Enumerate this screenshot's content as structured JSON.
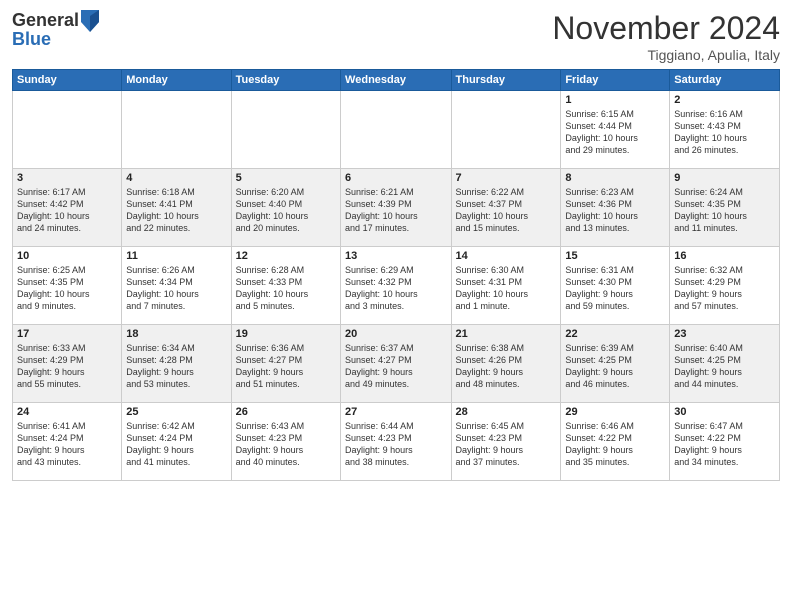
{
  "header": {
    "logo_general": "General",
    "logo_blue": "Blue",
    "month_title": "November 2024",
    "location": "Tiggiano, Apulia, Italy"
  },
  "weekdays": [
    "Sunday",
    "Monday",
    "Tuesday",
    "Wednesday",
    "Thursday",
    "Friday",
    "Saturday"
  ],
  "weeks": [
    [
      {
        "day": "",
        "info": ""
      },
      {
        "day": "",
        "info": ""
      },
      {
        "day": "",
        "info": ""
      },
      {
        "day": "",
        "info": ""
      },
      {
        "day": "",
        "info": ""
      },
      {
        "day": "1",
        "info": "Sunrise: 6:15 AM\nSunset: 4:44 PM\nDaylight: 10 hours\nand 29 minutes."
      },
      {
        "day": "2",
        "info": "Sunrise: 6:16 AM\nSunset: 4:43 PM\nDaylight: 10 hours\nand 26 minutes."
      }
    ],
    [
      {
        "day": "3",
        "info": "Sunrise: 6:17 AM\nSunset: 4:42 PM\nDaylight: 10 hours\nand 24 minutes."
      },
      {
        "day": "4",
        "info": "Sunrise: 6:18 AM\nSunset: 4:41 PM\nDaylight: 10 hours\nand 22 minutes."
      },
      {
        "day": "5",
        "info": "Sunrise: 6:20 AM\nSunset: 4:40 PM\nDaylight: 10 hours\nand 20 minutes."
      },
      {
        "day": "6",
        "info": "Sunrise: 6:21 AM\nSunset: 4:39 PM\nDaylight: 10 hours\nand 17 minutes."
      },
      {
        "day": "7",
        "info": "Sunrise: 6:22 AM\nSunset: 4:37 PM\nDaylight: 10 hours\nand 15 minutes."
      },
      {
        "day": "8",
        "info": "Sunrise: 6:23 AM\nSunset: 4:36 PM\nDaylight: 10 hours\nand 13 minutes."
      },
      {
        "day": "9",
        "info": "Sunrise: 6:24 AM\nSunset: 4:35 PM\nDaylight: 10 hours\nand 11 minutes."
      }
    ],
    [
      {
        "day": "10",
        "info": "Sunrise: 6:25 AM\nSunset: 4:35 PM\nDaylight: 10 hours\nand 9 minutes."
      },
      {
        "day": "11",
        "info": "Sunrise: 6:26 AM\nSunset: 4:34 PM\nDaylight: 10 hours\nand 7 minutes."
      },
      {
        "day": "12",
        "info": "Sunrise: 6:28 AM\nSunset: 4:33 PM\nDaylight: 10 hours\nand 5 minutes."
      },
      {
        "day": "13",
        "info": "Sunrise: 6:29 AM\nSunset: 4:32 PM\nDaylight: 10 hours\nand 3 minutes."
      },
      {
        "day": "14",
        "info": "Sunrise: 6:30 AM\nSunset: 4:31 PM\nDaylight: 10 hours\nand 1 minute."
      },
      {
        "day": "15",
        "info": "Sunrise: 6:31 AM\nSunset: 4:30 PM\nDaylight: 9 hours\nand 59 minutes."
      },
      {
        "day": "16",
        "info": "Sunrise: 6:32 AM\nSunset: 4:29 PM\nDaylight: 9 hours\nand 57 minutes."
      }
    ],
    [
      {
        "day": "17",
        "info": "Sunrise: 6:33 AM\nSunset: 4:29 PM\nDaylight: 9 hours\nand 55 minutes."
      },
      {
        "day": "18",
        "info": "Sunrise: 6:34 AM\nSunset: 4:28 PM\nDaylight: 9 hours\nand 53 minutes."
      },
      {
        "day": "19",
        "info": "Sunrise: 6:36 AM\nSunset: 4:27 PM\nDaylight: 9 hours\nand 51 minutes."
      },
      {
        "day": "20",
        "info": "Sunrise: 6:37 AM\nSunset: 4:27 PM\nDaylight: 9 hours\nand 49 minutes."
      },
      {
        "day": "21",
        "info": "Sunrise: 6:38 AM\nSunset: 4:26 PM\nDaylight: 9 hours\nand 48 minutes."
      },
      {
        "day": "22",
        "info": "Sunrise: 6:39 AM\nSunset: 4:25 PM\nDaylight: 9 hours\nand 46 minutes."
      },
      {
        "day": "23",
        "info": "Sunrise: 6:40 AM\nSunset: 4:25 PM\nDaylight: 9 hours\nand 44 minutes."
      }
    ],
    [
      {
        "day": "24",
        "info": "Sunrise: 6:41 AM\nSunset: 4:24 PM\nDaylight: 9 hours\nand 43 minutes."
      },
      {
        "day": "25",
        "info": "Sunrise: 6:42 AM\nSunset: 4:24 PM\nDaylight: 9 hours\nand 41 minutes."
      },
      {
        "day": "26",
        "info": "Sunrise: 6:43 AM\nSunset: 4:23 PM\nDaylight: 9 hours\nand 40 minutes."
      },
      {
        "day": "27",
        "info": "Sunrise: 6:44 AM\nSunset: 4:23 PM\nDaylight: 9 hours\nand 38 minutes."
      },
      {
        "day": "28",
        "info": "Sunrise: 6:45 AM\nSunset: 4:23 PM\nDaylight: 9 hours\nand 37 minutes."
      },
      {
        "day": "29",
        "info": "Sunrise: 6:46 AM\nSunset: 4:22 PM\nDaylight: 9 hours\nand 35 minutes."
      },
      {
        "day": "30",
        "info": "Sunrise: 6:47 AM\nSunset: 4:22 PM\nDaylight: 9 hours\nand 34 minutes."
      }
    ]
  ]
}
